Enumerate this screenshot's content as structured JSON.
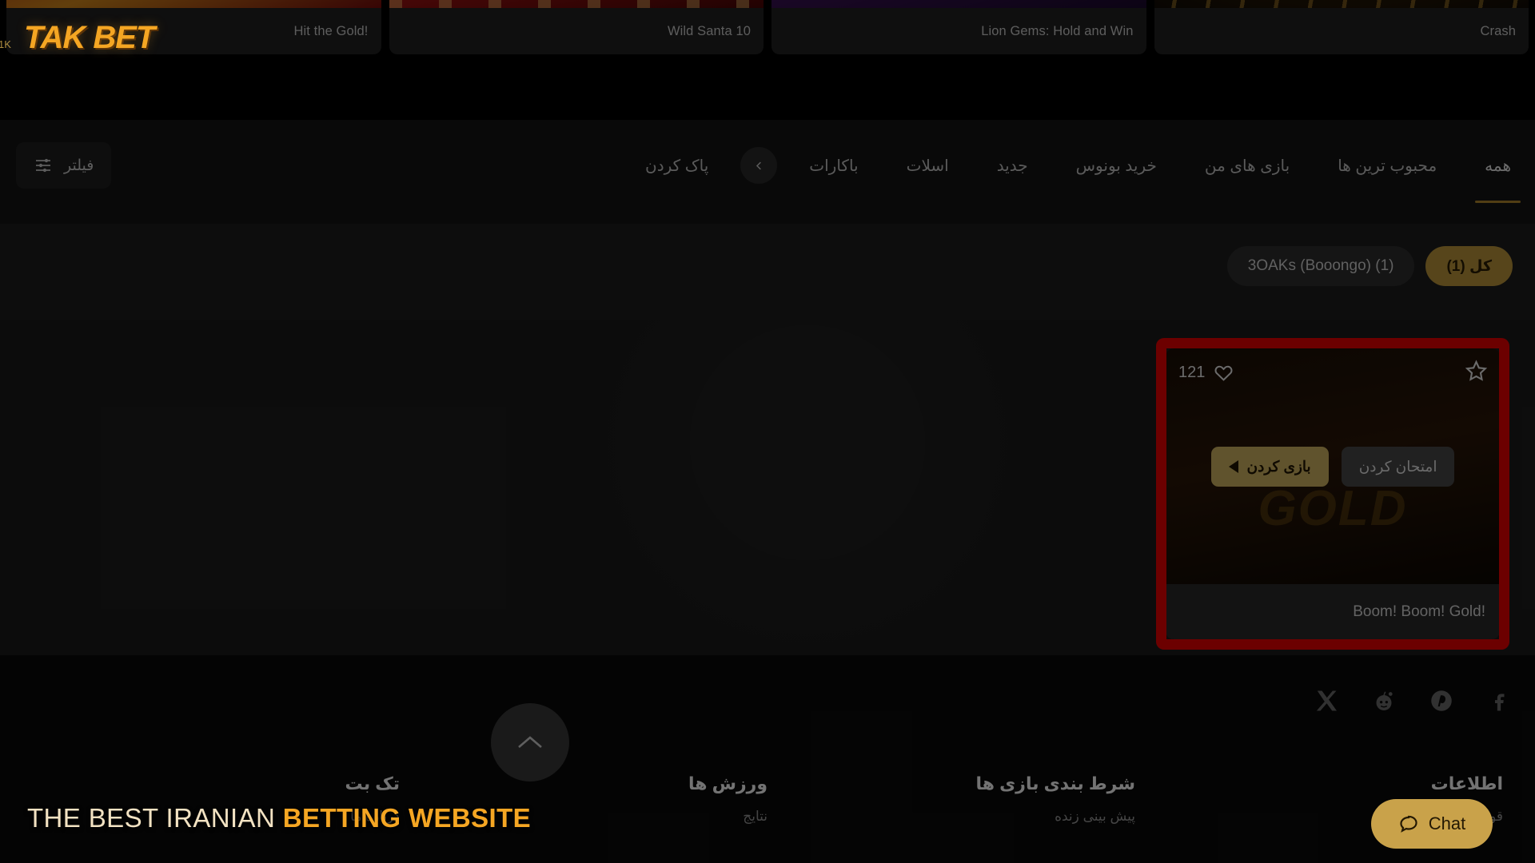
{
  "brand": {
    "logo": "TAK BET",
    "mini_badge": "1K"
  },
  "top_cards": [
    {
      "title": "Crash",
      "art": "th-crash"
    },
    {
      "title": "Lion Gems: Hold and Win",
      "art": "th-lion"
    },
    {
      "title": "Wild Santa 10",
      "art": "th-santa"
    },
    {
      "title": "Hit the Gold!",
      "art": "th-hitgold"
    }
  ],
  "nav": {
    "tabs": [
      {
        "label": "همه",
        "active": true
      },
      {
        "label": "محبوب ترین ها",
        "active": false
      },
      {
        "label": "بازی های من",
        "active": false
      },
      {
        "label": "خرید بونوس",
        "active": false
      },
      {
        "label": "جدید",
        "active": false
      },
      {
        "label": "اسلات",
        "active": false
      },
      {
        "label": "باکارات",
        "active": false
      }
    ],
    "prev_arrow_icon": "chevron-left-icon",
    "clear_label": "پاک کردن",
    "filter_label": "فیلتر",
    "filter_icon": "sliders-icon"
  },
  "chips": [
    {
      "label": "کل (1)",
      "selected": true
    },
    {
      "label": "3OAKs (Booongo) (1)",
      "selected": false
    }
  ],
  "game_card": {
    "title": "Boom! Boom! Gold!",
    "likes": "121",
    "star_icon": "star-icon",
    "heart_icon": "heart-icon",
    "play_label": "بازی کردن",
    "demo_label": "امتحان کردن",
    "highlight_color": "#f00000"
  },
  "footer": {
    "socials": [
      {
        "name": "twitter-x-icon"
      },
      {
        "name": "reddit-icon"
      },
      {
        "name": "pinterest-icon"
      },
      {
        "name": "facebook-icon"
      }
    ],
    "scroll_top_icon": "chevron-up-icon",
    "columns": [
      {
        "title": "تک بت",
        "links": [
          "درباره ما"
        ]
      },
      {
        "title": "ورزش ها",
        "links": [
          "نتایج"
        ]
      },
      {
        "title": "شرط بندی بازی ها",
        "links": [
          "پیش بینی زنده"
        ]
      },
      {
        "title": "اطلاعات",
        "links": [
          "قوانین عمومی"
        ]
      }
    ],
    "chat_label": "Chat",
    "chat_icon": "chat-bubble-icon"
  },
  "watermark": {
    "prefix": "THE BEST IRANIAN ",
    "highlight": "BETTING WEBSITE"
  }
}
